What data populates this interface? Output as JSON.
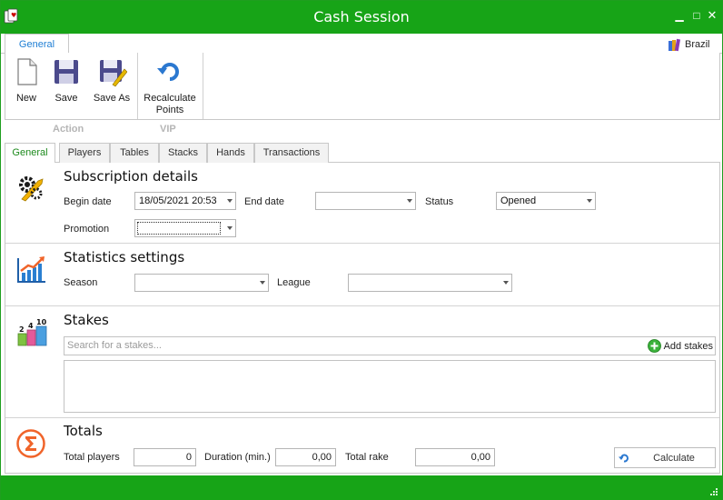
{
  "window": {
    "title": "Cash Session"
  },
  "ribbon": {
    "tab_general": "General",
    "country": "Brazil",
    "buttons": {
      "new": "New",
      "save": "Save",
      "save_as": "Save As",
      "recalculate_line1": "Recalculate",
      "recalculate_line2": "Points"
    },
    "groups": {
      "action": "Action",
      "vip": "VIP"
    }
  },
  "tabs": [
    "General",
    "Players",
    "Tables",
    "Stacks",
    "Hands",
    "Transactions"
  ],
  "subscription": {
    "title": "Subscription details",
    "begin_date_label": "Begin date",
    "begin_date_value": "18/05/2021 20:53",
    "end_date_label": "End date",
    "end_date_value": "",
    "status_label": "Status",
    "status_value": "Opened",
    "promotion_label": "Promotion",
    "promotion_value": ""
  },
  "statistics": {
    "title": "Statistics settings",
    "season_label": "Season",
    "season_value": "",
    "league_label": "League",
    "league_value": ""
  },
  "stakes": {
    "title": "Stakes",
    "icon_numbers": [
      "2",
      "4",
      "10"
    ],
    "search_placeholder": "Search for a stakes...",
    "add_label": "Add stakes"
  },
  "totals": {
    "title": "Totals",
    "players_label": "Total players",
    "players_value": "0",
    "duration_label": "Duration (min.)",
    "duration_value": "0,00",
    "rake_label": "Total rake",
    "rake_value": "0,00",
    "calculate_label": "Calculate"
  },
  "colors": {
    "accent": "#17a417",
    "tab_blue": "#1e7ed4",
    "orange": "#f0642a"
  }
}
